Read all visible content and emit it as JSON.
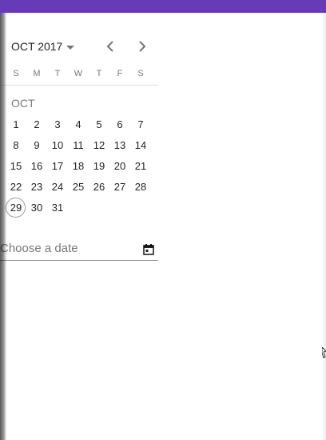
{
  "colors": {
    "accent": "#673ab7",
    "text": "#212121",
    "secondary_text": "#757575"
  },
  "calendar": {
    "period_label": "OCT 2017",
    "period_caret_icon": "arrow-drop-down-icon",
    "prev_icon": "chevron-left-icon",
    "next_icon": "chevron-right-icon",
    "weekdays": [
      "S",
      "M",
      "T",
      "W",
      "T",
      "F",
      "S"
    ],
    "month_label": "OCT",
    "first_day_offset": 0,
    "days": [
      "1",
      "2",
      "3",
      "4",
      "5",
      "6",
      "7",
      "8",
      "9",
      "10",
      "11",
      "12",
      "13",
      "14",
      "15",
      "16",
      "17",
      "18",
      "19",
      "20",
      "21",
      "22",
      "23",
      "24",
      "25",
      "26",
      "27",
      "28",
      "29",
      "30",
      "31"
    ],
    "today": "29"
  },
  "date_field": {
    "placeholder": "Choose a date",
    "value": "",
    "toggle_icon": "calendar-today-icon"
  }
}
